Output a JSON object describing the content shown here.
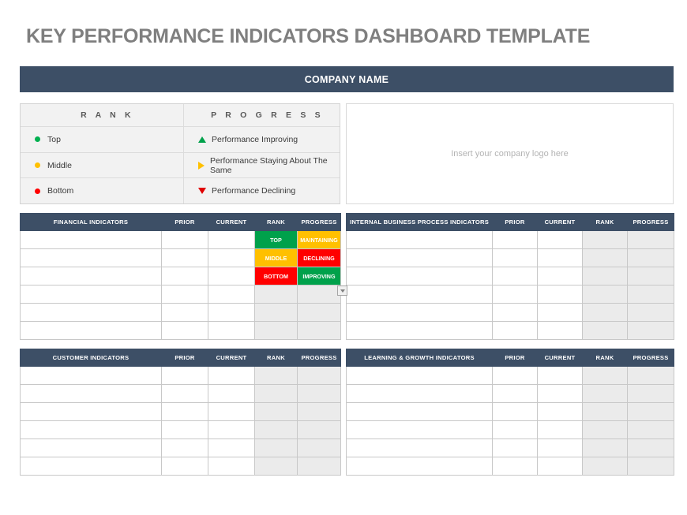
{
  "page_title": "KEY PERFORMANCE INDICATORS DASHBOARD TEMPLATE",
  "banner": {
    "company_name": "COMPANY NAME"
  },
  "legend": {
    "rank_header": "R A N K",
    "progress_header": "P R O G R E S S",
    "rows": [
      {
        "rank_label": "Top",
        "rank_color": "#00b050",
        "progress_label": "Performance Improving",
        "progress_icon": "triangle-up-icon",
        "progress_color": "#00a14b"
      },
      {
        "rank_label": "Middle",
        "rank_color": "#ffc000",
        "progress_label": "Performance Staying About The Same",
        "progress_icon": "triangle-right-icon",
        "progress_color": "#ffc000"
      },
      {
        "rank_label": "Bottom",
        "rank_color": "#ff0000",
        "progress_label": "Performance Declining",
        "progress_icon": "triangle-down-icon",
        "progress_color": "#e00000"
      }
    ]
  },
  "logo_box": {
    "placeholder": "Insert your company logo here"
  },
  "common_columns": {
    "prior": "PRIOR",
    "current": "CURRENT",
    "rank": "RANK",
    "progress": "PROGRESS"
  },
  "tables": {
    "financial": {
      "title": "FINANCIAL INDICATORS",
      "rows": [
        {
          "name": "",
          "prior": "",
          "current": "",
          "rank": "TOP",
          "rank_fill": "green",
          "progress": "MAINTAINING",
          "progress_fill": "yellow"
        },
        {
          "name": "",
          "prior": "",
          "current": "",
          "rank": "MIDDLE",
          "rank_fill": "yellow",
          "progress": "DECLINING",
          "progress_fill": "red"
        },
        {
          "name": "",
          "prior": "",
          "current": "",
          "rank": "BOTTOM",
          "rank_fill": "red",
          "progress": "IMPROVING",
          "progress_fill": "green"
        },
        {
          "name": "",
          "prior": "",
          "current": "",
          "rank": "",
          "rank_fill": "shade",
          "progress": "",
          "progress_fill": "shade"
        },
        {
          "name": "",
          "prior": "",
          "current": "",
          "rank": "",
          "rank_fill": "shade",
          "progress": "",
          "progress_fill": "shade"
        },
        {
          "name": "",
          "prior": "",
          "current": "",
          "rank": "",
          "rank_fill": "shade",
          "progress": "",
          "progress_fill": "shade"
        }
      ]
    },
    "internal": {
      "title": "INTERNAL BUSINESS  PROCESS  INDICATORS",
      "rows": [
        {
          "name": "",
          "prior": "",
          "current": "",
          "rank": "",
          "rank_fill": "shade",
          "progress": "",
          "progress_fill": "shade"
        },
        {
          "name": "",
          "prior": "",
          "current": "",
          "rank": "",
          "rank_fill": "shade",
          "progress": "",
          "progress_fill": "shade"
        },
        {
          "name": "",
          "prior": "",
          "current": "",
          "rank": "",
          "rank_fill": "shade",
          "progress": "",
          "progress_fill": "shade"
        },
        {
          "name": "",
          "prior": "",
          "current": "",
          "rank": "",
          "rank_fill": "shade",
          "progress": "",
          "progress_fill": "shade"
        },
        {
          "name": "",
          "prior": "",
          "current": "",
          "rank": "",
          "rank_fill": "shade",
          "progress": "",
          "progress_fill": "shade"
        },
        {
          "name": "",
          "prior": "",
          "current": "",
          "rank": "",
          "rank_fill": "shade",
          "progress": "",
          "progress_fill": "shade"
        }
      ]
    },
    "customer": {
      "title": "CUSTOMER INDICATORS",
      "rows": [
        {
          "name": "",
          "prior": "",
          "current": "",
          "rank": "",
          "rank_fill": "shade",
          "progress": "",
          "progress_fill": "shade"
        },
        {
          "name": "",
          "prior": "",
          "current": "",
          "rank": "",
          "rank_fill": "shade",
          "progress": "",
          "progress_fill": "shade"
        },
        {
          "name": "",
          "prior": "",
          "current": "",
          "rank": "",
          "rank_fill": "shade",
          "progress": "",
          "progress_fill": "shade"
        },
        {
          "name": "",
          "prior": "",
          "current": "",
          "rank": "",
          "rank_fill": "shade",
          "progress": "",
          "progress_fill": "shade"
        },
        {
          "name": "",
          "prior": "",
          "current": "",
          "rank": "",
          "rank_fill": "shade",
          "progress": "",
          "progress_fill": "shade"
        },
        {
          "name": "",
          "prior": "",
          "current": "",
          "rank": "",
          "rank_fill": "shade",
          "progress": "",
          "progress_fill": "shade"
        }
      ]
    },
    "learning": {
      "title": "LEARNING & GROWTH INDICATORS",
      "rows": [
        {
          "name": "",
          "prior": "",
          "current": "",
          "rank": "",
          "rank_fill": "shade",
          "progress": "",
          "progress_fill": "shade"
        },
        {
          "name": "",
          "prior": "",
          "current": "",
          "rank": "",
          "rank_fill": "shade",
          "progress": "",
          "progress_fill": "shade"
        },
        {
          "name": "",
          "prior": "",
          "current": "",
          "rank": "",
          "rank_fill": "shade",
          "progress": "",
          "progress_fill": "shade"
        },
        {
          "name": "",
          "prior": "",
          "current": "",
          "rank": "",
          "rank_fill": "shade",
          "progress": "",
          "progress_fill": "shade"
        },
        {
          "name": "",
          "prior": "",
          "current": "",
          "rank": "",
          "rank_fill": "shade",
          "progress": "",
          "progress_fill": "shade"
        },
        {
          "name": "",
          "prior": "",
          "current": "",
          "rank": "",
          "rank_fill": "shade",
          "progress": "",
          "progress_fill": "shade"
        }
      ]
    }
  },
  "colors": {
    "header_navy": "#3d4f66",
    "green": "#00a14b",
    "yellow": "#ffc000",
    "red": "#ff0000",
    "shade": "#ebebeb"
  }
}
